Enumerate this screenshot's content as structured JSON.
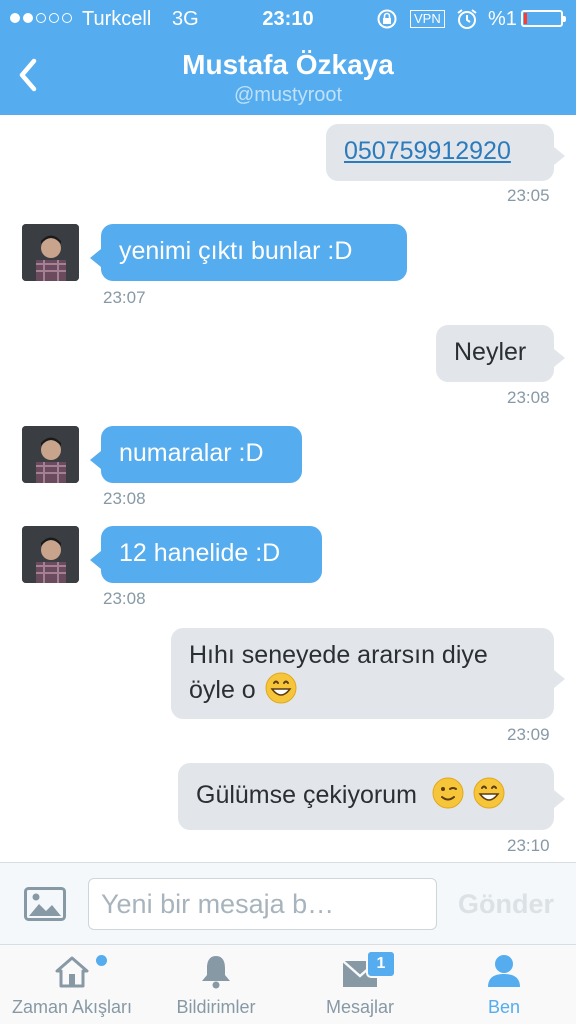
{
  "status_bar": {
    "carrier": "Turkcell",
    "network": "3G",
    "time": "23:10",
    "vpn": "VPN",
    "battery": "%1",
    "signal_bars": 2
  },
  "header": {
    "name": "Mustafa Özkaya",
    "handle": "@mustyroot"
  },
  "messages": [
    {
      "direction": "out",
      "text": "050759912920",
      "time": "23:05"
    },
    {
      "direction": "in",
      "text": "yenimi çıktı bunlar :D",
      "time": "23:07"
    },
    {
      "direction": "out",
      "text": "Neyler",
      "time": "23:08"
    },
    {
      "direction": "in",
      "text": "numaralar :D",
      "time": "23:08"
    },
    {
      "direction": "in",
      "text": "12 hanelide :D",
      "time": "23:08"
    },
    {
      "direction": "out",
      "text_line1": "Hıhı seneyede ararsın diye",
      "text_line2": "öyle o",
      "emoji": "grinning-emoji",
      "time": "23:09"
    },
    {
      "direction": "out",
      "text": "Gülümse çekiyorum",
      "emoji": [
        "winking-emoji",
        "grinning-emoji"
      ],
      "time": "23:10"
    }
  ],
  "composer": {
    "placeholder": "Yeni bir mesaja b…",
    "send_label": "Gönder"
  },
  "tabs": [
    {
      "label": "Zaman Akışları",
      "icon": "home-icon"
    },
    {
      "label": "Bildirimler",
      "icon": "bell-icon"
    },
    {
      "label": "Mesajlar",
      "icon": "envelope-icon",
      "badge": "1"
    },
    {
      "label": "Ben",
      "icon": "person-icon",
      "active": true
    }
  ],
  "colors": {
    "brand": "#55acee",
    "incoming_bubble": "#55acee",
    "outgoing_bubble": "#e2e6ea",
    "timestamp": "#8899a6"
  }
}
